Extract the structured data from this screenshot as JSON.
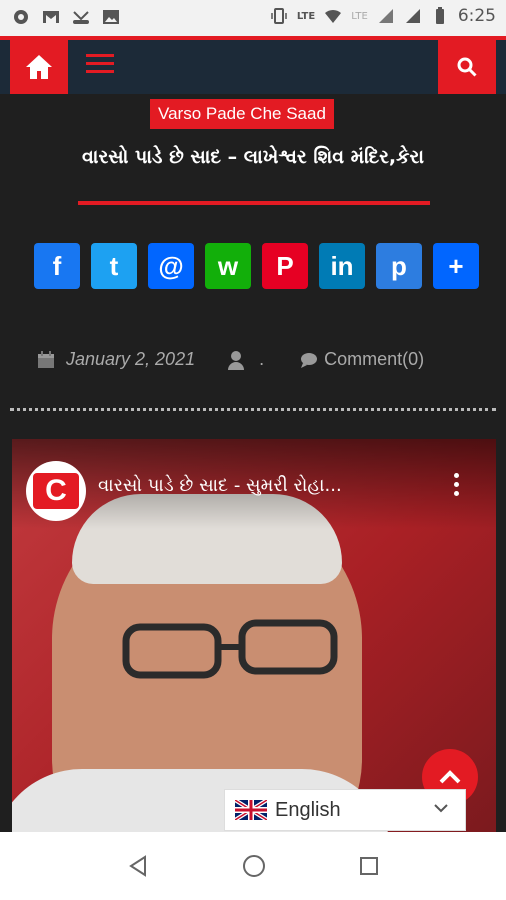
{
  "status_bar": {
    "time": "6:25",
    "network_label_1": "LTE",
    "network_label_2": "LTE"
  },
  "nav": {
    "home_icon": "home-icon",
    "menu_icon": "hamburger-icon",
    "search_icon": "search-icon"
  },
  "article": {
    "category": "Varso Pade Che Saad",
    "title": "વારસો પાડે છે સાદ – લાખેશ્વર શિવ મંદિર,કેરા",
    "date": "January 2, 2021",
    "author": ".",
    "comment_label": "Comment(0)"
  },
  "share": [
    {
      "name": "facebook",
      "glyph": "f",
      "color": "#1877f2"
    },
    {
      "name": "twitter",
      "glyph": "t",
      "color": "#1da1f2"
    },
    {
      "name": "email",
      "glyph": "@",
      "color": "#0166ff"
    },
    {
      "name": "whatsapp",
      "glyph": "w",
      "color": "#12af0a"
    },
    {
      "name": "pinterest",
      "glyph": "P",
      "color": "#e60023"
    },
    {
      "name": "linkedin",
      "glyph": "in",
      "color": "#007bb5"
    },
    {
      "name": "print",
      "glyph": "p",
      "color": "#2d7de0"
    },
    {
      "name": "share",
      "glyph": "+",
      "color": "#0166ff"
    }
  ],
  "video": {
    "channel_logo_text": "C",
    "title": "વારસો પાડે છે સાદ - સુમરી રોહા..."
  },
  "language": {
    "selected": "English"
  },
  "colors": {
    "accent": "#e31b23",
    "nav_bg": "#1c2a38",
    "page_bg": "#1f1f1f"
  }
}
